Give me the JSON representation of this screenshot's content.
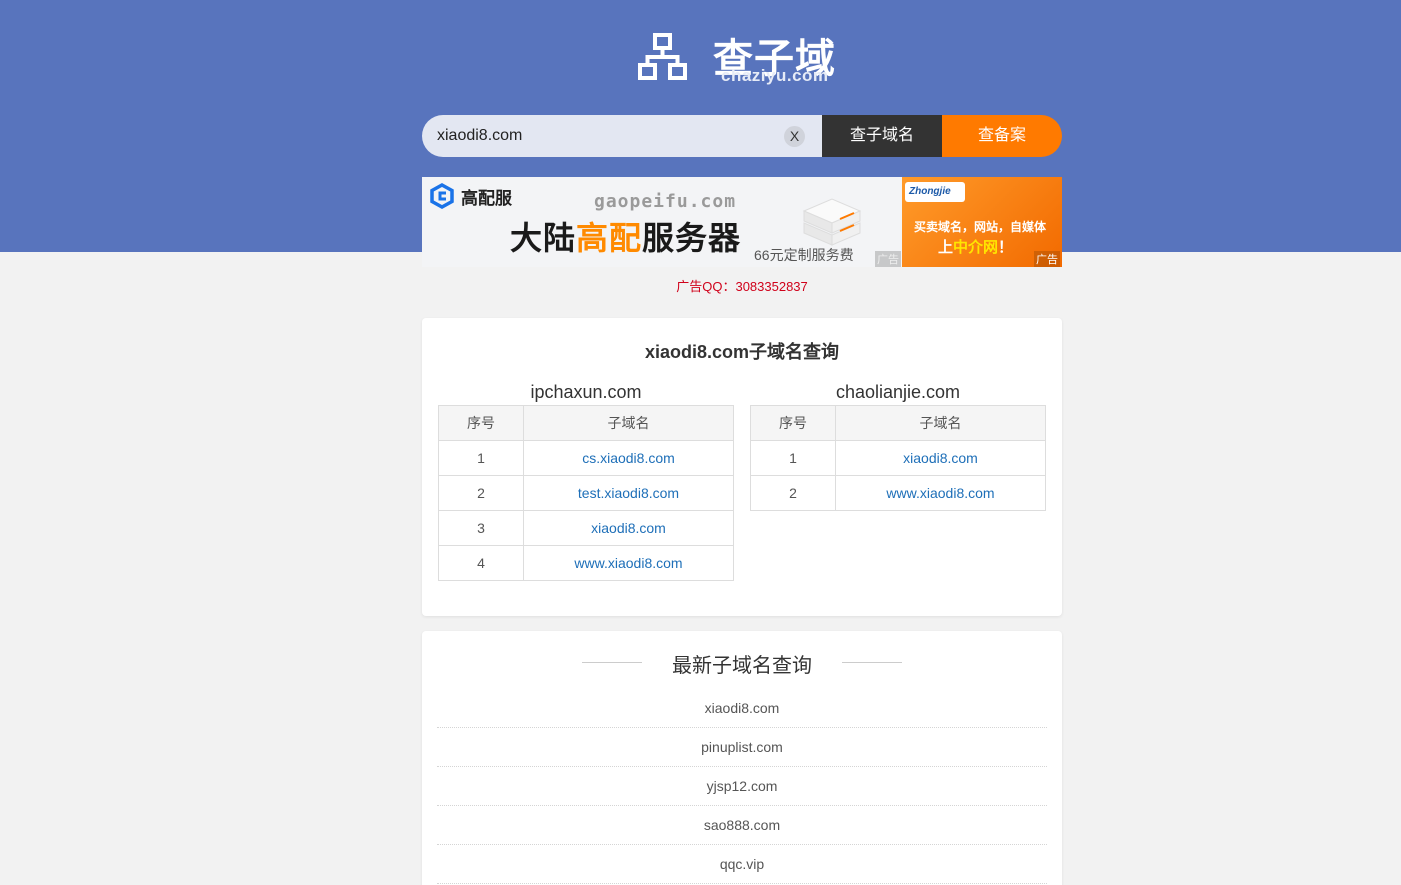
{
  "header": {
    "logo_cn": "查子域",
    "logo_en": "chaziyu.com"
  },
  "search": {
    "value": "xiaodi8.com",
    "clear_label": "X",
    "subdomain_button": "查子域名",
    "icp_button": "查备案"
  },
  "ads": {
    "left": {
      "brand": "高配服",
      "domain": "gaopeifu.com",
      "headline_part1": "大陆",
      "headline_highlight": "高配",
      "headline_part2": "服务器",
      "price_text": "66元定制服务费",
      "tag": "广告"
    },
    "right": {
      "logo": "Zhongjie",
      "line1": "买卖域名，网站，自媒体",
      "line2_prefix": "上",
      "line2_highlight": "中介网",
      "line2_suffix": "！",
      "tag": "广告"
    },
    "contact": "广告QQ：3083352837"
  },
  "result": {
    "title": "xiaodi8.com子域名查询",
    "columns": [
      "序号",
      "子域名"
    ],
    "tables": [
      {
        "source": "ipchaxun.com",
        "rows": [
          {
            "index": "1",
            "subdomain": "cs.xiaodi8.com"
          },
          {
            "index": "2",
            "subdomain": "test.xiaodi8.com"
          },
          {
            "index": "3",
            "subdomain": "xiaodi8.com"
          },
          {
            "index": "4",
            "subdomain": "www.xiaodi8.com"
          }
        ]
      },
      {
        "source": "chaolianjie.com",
        "rows": [
          {
            "index": "1",
            "subdomain": "xiaodi8.com"
          },
          {
            "index": "2",
            "subdomain": "www.xiaodi8.com"
          }
        ]
      }
    ]
  },
  "latest": {
    "title": "最新子域名查询",
    "items": [
      "xiaodi8.com",
      "pinuplist.com",
      "yjsp12.com",
      "sao888.com",
      "qqc.vip"
    ]
  },
  "colors": {
    "header_bg": "#5874bd",
    "search_button_dark": "#333333",
    "search_button_orange": "#ff7a00",
    "link": "#1e6fb8",
    "ad_contact": "#d0021b"
  }
}
